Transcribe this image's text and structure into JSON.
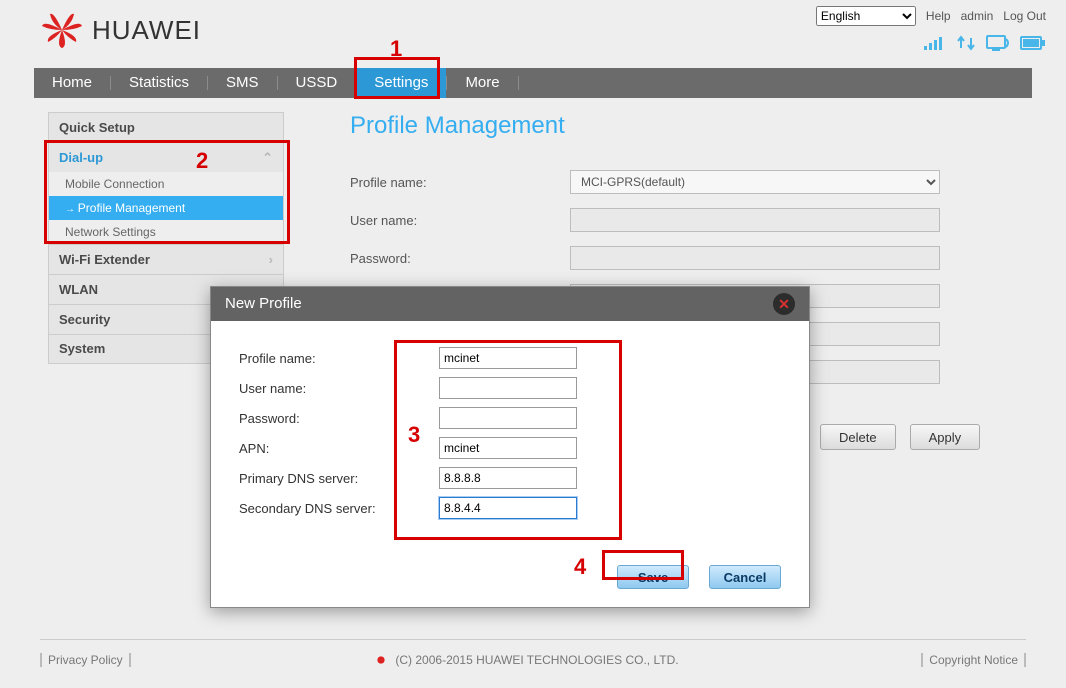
{
  "topbar": {
    "language": "English",
    "help": "Help",
    "user": "admin",
    "logout": "Log Out"
  },
  "brand": "HUAWEI",
  "nav": {
    "home": "Home",
    "statistics": "Statistics",
    "sms": "SMS",
    "ussd": "USSD",
    "settings": "Settings",
    "more": "More"
  },
  "sidebar": {
    "quick_setup": "Quick Setup",
    "dialup": "Dial-up",
    "dialup_items": {
      "mobile_connection": "Mobile Connection",
      "profile_management": "Profile Management",
      "network_settings": "Network Settings"
    },
    "wifi_extender": "Wi-Fi Extender",
    "wlan": "WLAN",
    "security": "Security",
    "system": "System"
  },
  "main": {
    "title": "Profile Management",
    "labels": {
      "profile_name": "Profile name:",
      "user_name": "User name:",
      "password": "Password:"
    },
    "profile_select": "MCI-GPRS(default)",
    "buttons": {
      "delete": "Delete",
      "apply": "Apply"
    }
  },
  "modal": {
    "title": "New Profile",
    "labels": {
      "profile_name": "Profile name:",
      "user_name": "User name:",
      "password": "Password:",
      "apn": "APN:",
      "primary_dns": "Primary DNS server:",
      "secondary_dns": "Secondary DNS server:"
    },
    "values": {
      "profile_name": "mcinet",
      "user_name": "",
      "password": "",
      "apn": "mcinet",
      "primary_dns": "8.8.8.8",
      "secondary_dns": "8.8.4.4"
    },
    "buttons": {
      "save": "Save",
      "cancel": "Cancel"
    }
  },
  "footer": {
    "privacy": "Privacy Policy",
    "copyright_text": "(C) 2006-2015 HUAWEI TECHNOLOGIES CO., LTD.",
    "copyright_notice": "Copyright Notice"
  },
  "annotations": {
    "n1": "1",
    "n2": "2",
    "n3": "3",
    "n4": "4"
  }
}
